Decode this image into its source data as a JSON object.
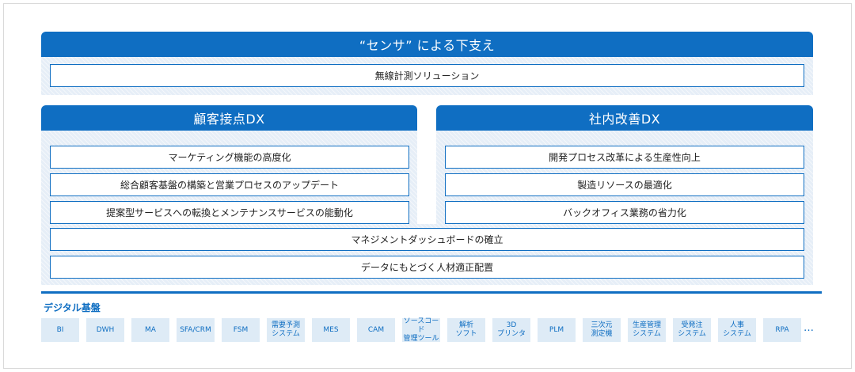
{
  "top_section": {
    "title": "“センサ” による下支え",
    "items": [
      "無線計測ソリューション"
    ]
  },
  "customer_section": {
    "title": "顧客接点DX",
    "items": [
      "マーケティング機能の高度化",
      "総合顧客基盤の構築と営業プロセスのアップデート",
      "提案型サービスへの転換とメンテナンスサービスの能動化"
    ]
  },
  "internal_section": {
    "title": "社内改善DX",
    "items": [
      "開発プロセス改革による生産性向上",
      "製造リソースの最適化",
      "バックオフィス業務の省力化"
    ]
  },
  "shared_items": [
    "マネジメントダッシュボードの確立",
    "データにもとづく人材適正配置"
  ],
  "digital_base": {
    "title": "デジタル基盤",
    "tiles": [
      "BI",
      "DWH",
      "MA",
      "SFA/CRM",
      "FSM",
      "需要予測\nシステム",
      "MES",
      "CAM",
      "ソースコード\n管理ツール",
      "解析\nソフト",
      "3D\nプリンタ",
      "PLM",
      "三次元\n測定機",
      "生産管理\nシステム",
      "受発注\nシステム",
      "人事\nシステム",
      "RPA"
    ],
    "more": "…"
  },
  "colors": {
    "accent": "#0f6ec2",
    "hatch": "#e6eef7",
    "tile": "#deebf6"
  }
}
